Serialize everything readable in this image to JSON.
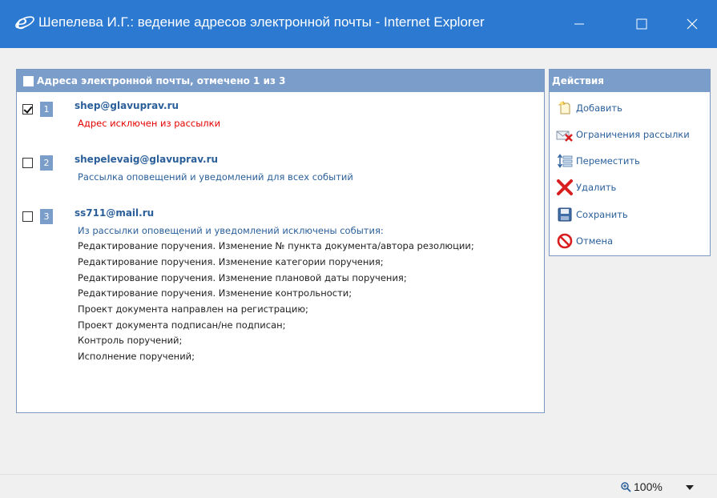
{
  "window": {
    "title": "Шепелева И.Г.: ведение адресов электронной почты - Internet Explorer",
    "accent": "#2b79d0"
  },
  "panel": {
    "header": "Адреса электронной почты, отмечено 1 из 3",
    "header_color": "#7b9dc9",
    "entries": [
      {
        "number": "1",
        "checked": true,
        "email": "shep@glavuprav.ru",
        "lines": [
          "Адрес исключен из рассылки"
        ]
      },
      {
        "number": "2",
        "checked": false,
        "email": "shepelevaig@glavuprav.ru",
        "lines": [
          "Рассылка оповещений и уведомлений для всех событий"
        ]
      },
      {
        "number": "3",
        "checked": false,
        "email": "ss711@mail.ru",
        "lines": [
          "Из рассылки оповещений и уведомлений исключены события:",
          "Редактирование поручения. Изменение № пункта документа/автора резолюции;",
          "Редактирование поручения. Изменение категории поручения;",
          "Редактирование поручения. Изменение плановой даты поручения;",
          "Редактирование поручения. Изменение контрольности;",
          "Проект документа направлен на регистрацию;",
          "Проект документа подписан/не подписан;",
          "Контроль поручений;",
          "Исполнение поручений;"
        ]
      }
    ]
  },
  "actions": {
    "header": "Действия",
    "items": [
      {
        "label": "Добавить",
        "icon": "add-icon"
      },
      {
        "label": "Ограничения рассылки",
        "icon": "mail-restrict-icon"
      },
      {
        "label": "Переместить",
        "icon": "move-icon"
      },
      {
        "label": "Удалить",
        "icon": "delete-icon"
      },
      {
        "label": "Сохранить",
        "icon": "save-icon"
      },
      {
        "label": "Отмена",
        "icon": "cancel-icon"
      }
    ]
  },
  "statusbar": {
    "zoom": "100%"
  }
}
